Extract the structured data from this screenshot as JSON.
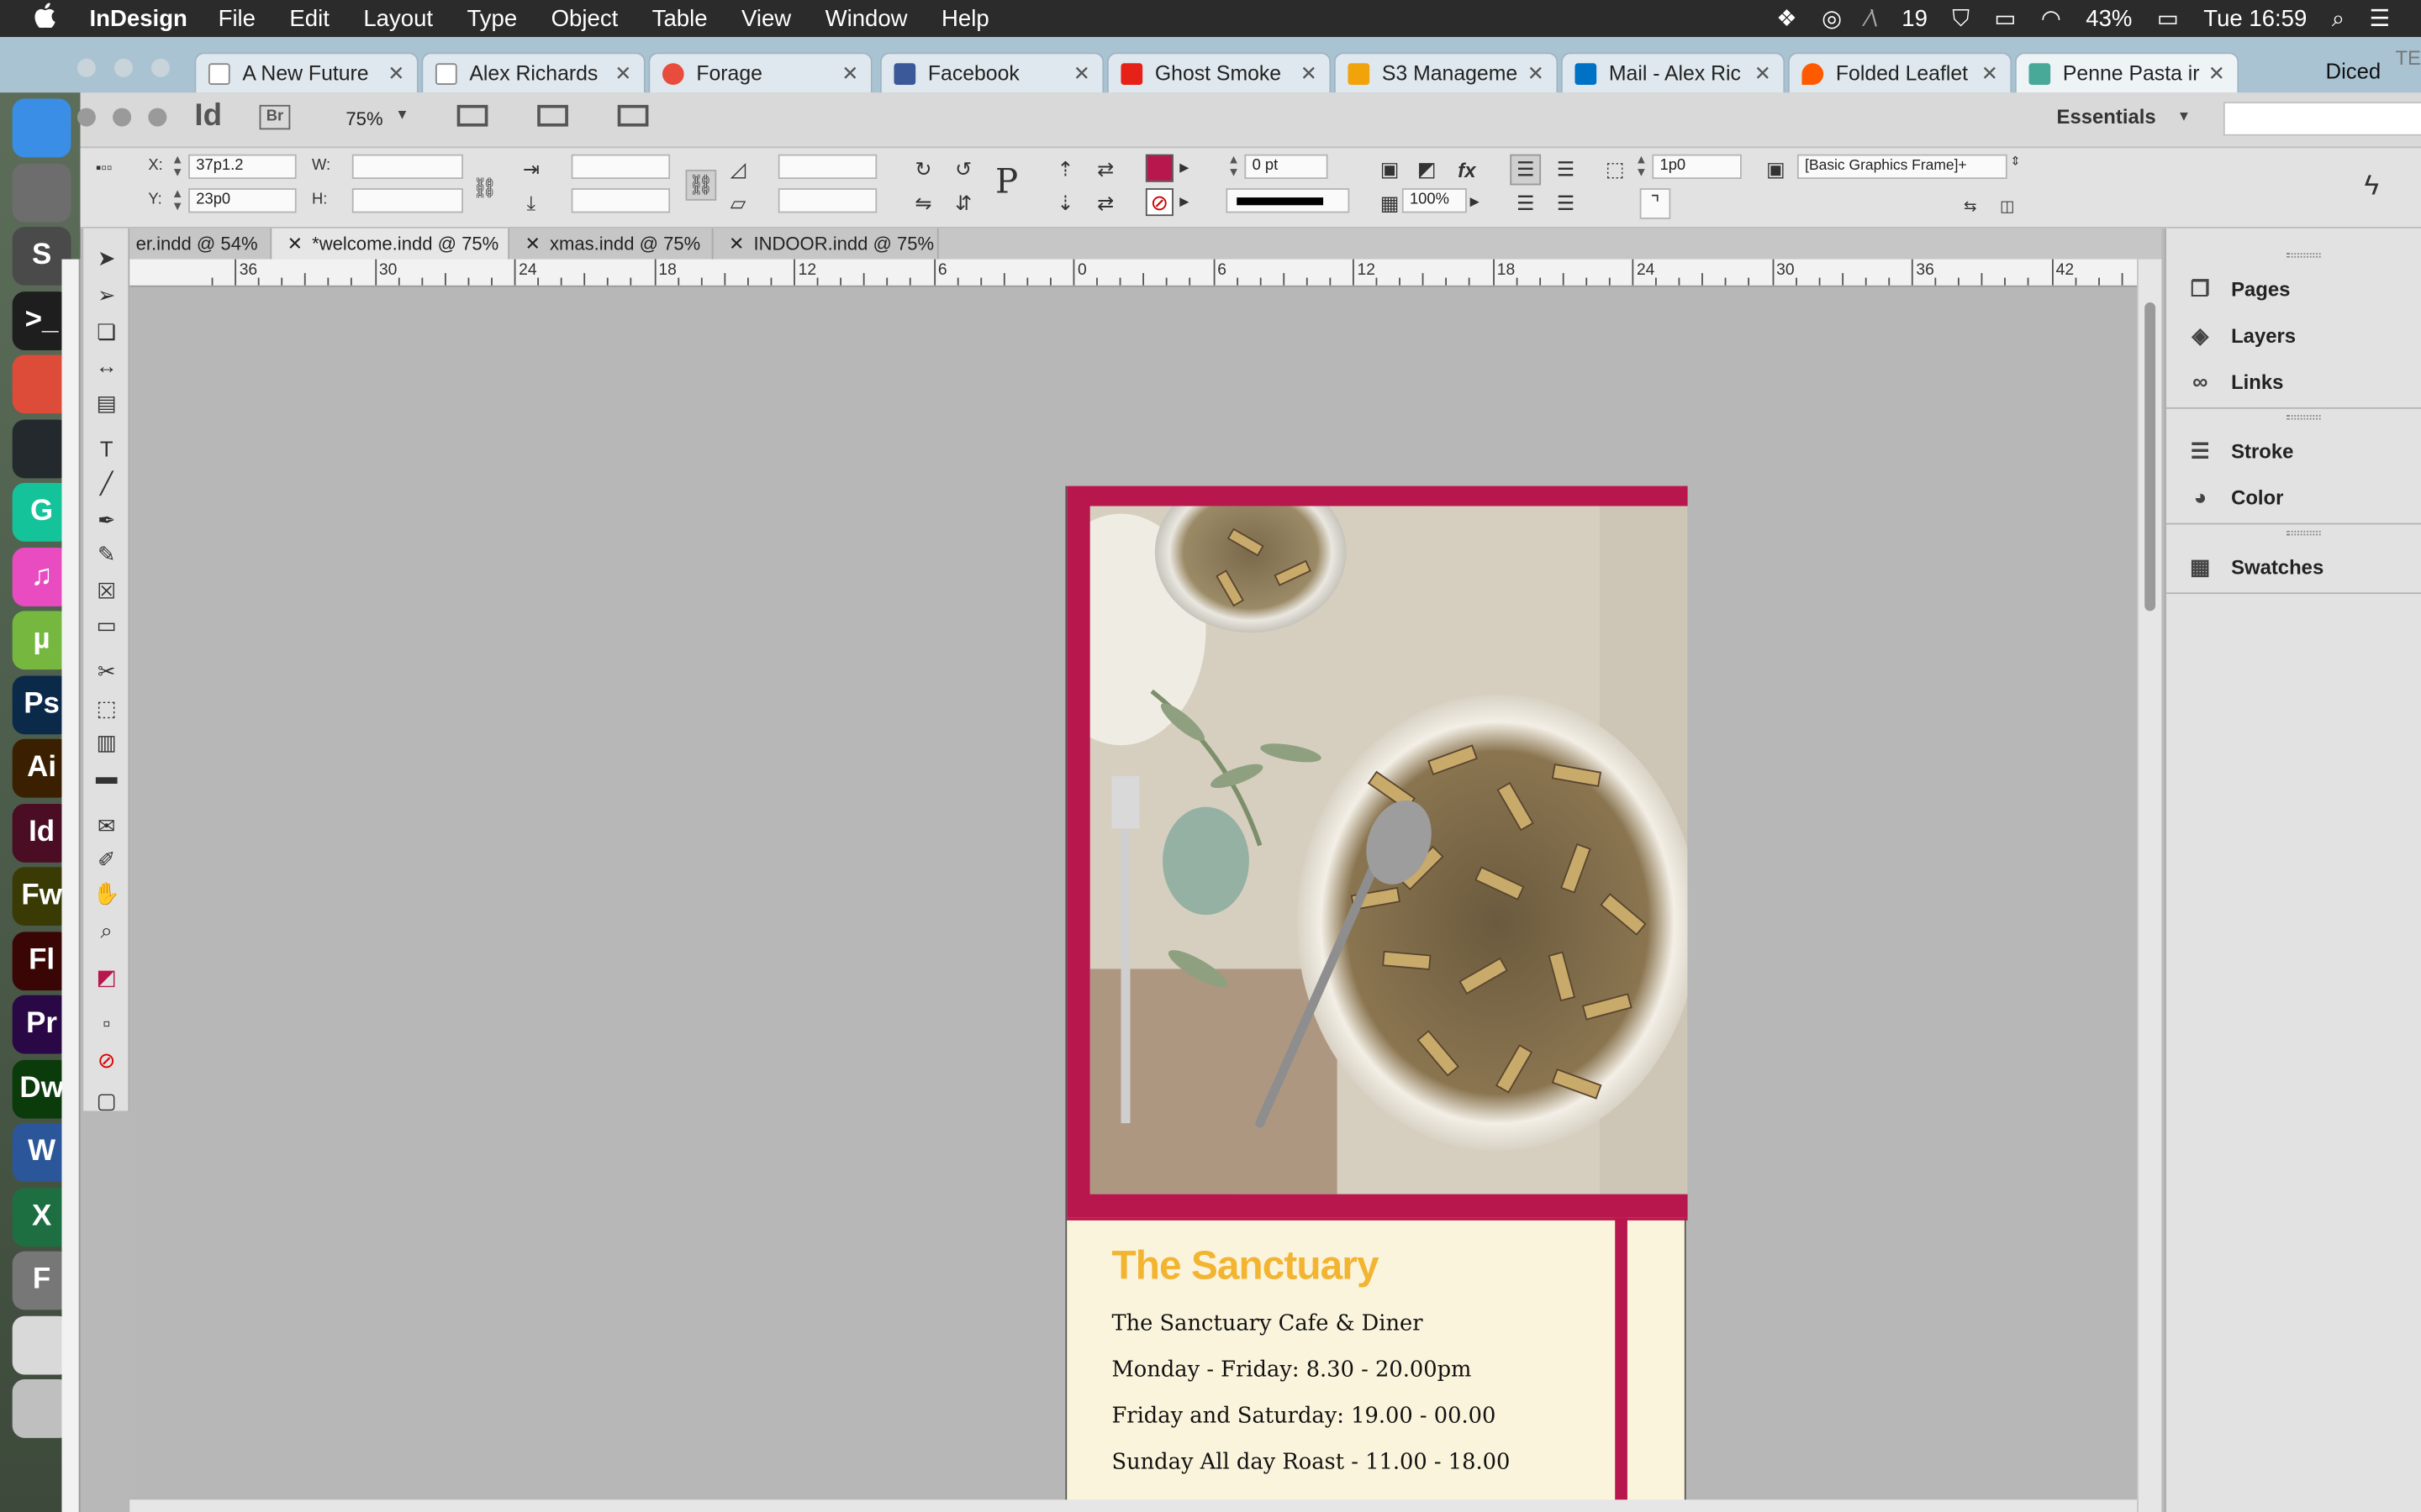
{
  "menubar": {
    "apple": "",
    "app": "InDesign",
    "menus": [
      "File",
      "Edit",
      "Layout",
      "Type",
      "Object",
      "Table",
      "View",
      "Window",
      "Help"
    ],
    "status": {
      "badge": "19",
      "battery": "43%",
      "clock": "Tue 16:59"
    }
  },
  "browser": {
    "tabs": [
      {
        "label": "A New Future",
        "icon_color": "#ffffff"
      },
      {
        "label": "Alex Richards",
        "icon_color": "#ffffff"
      },
      {
        "label": "Forage",
        "icon_color": "#e74c3c"
      },
      {
        "label": "Facebook",
        "icon_color": "#3b5998"
      },
      {
        "label": "Ghost Smoke",
        "icon_color": "#e62117"
      },
      {
        "label": "S3 Manageme",
        "icon_color": "#f0a30a"
      },
      {
        "label": "Mail - Alex Ric",
        "icon_color": "#0072c6"
      },
      {
        "label": "Folded Leaflet",
        "icon_color": "#ff5a00"
      },
      {
        "label": "Penne Pasta ir",
        "icon_color": "#48a999"
      }
    ],
    "profile": "Diced",
    "overflow": "TE"
  },
  "app": {
    "logo": "Id",
    "bridge": "Br",
    "zoom": "75%",
    "workspace": "Essentials"
  },
  "control": {
    "x_label": "X:",
    "x_value": "37p1.2",
    "y_label": "Y:",
    "y_value": "23p0",
    "w_label": "W:",
    "h_label": "H:",
    "stroke_weight": "0 pt",
    "opacity": "100%",
    "offset": "1p0",
    "object_style": "[Basic Graphics Frame]+",
    "fill_color": "#b8174e"
  },
  "doc_tabs": [
    {
      "label": "er.indd @ 54%"
    },
    {
      "label": "*welcome.indd @ 75%"
    },
    {
      "label": "xmas.indd @ 75%"
    },
    {
      "label": "INDOOR.indd @ 75%"
    }
  ],
  "ruler": {
    "labels": [
      "36",
      "30",
      "24",
      "18",
      "12",
      "6",
      "0",
      "6",
      "12",
      "18",
      "24",
      "30",
      "36",
      "42"
    ]
  },
  "document": {
    "title": "The Sanctuary",
    "lines": [
      "The Sanctuary Cafe & Diner",
      "Monday - Friday: 8.30 - 20.00pm",
      "Friday and Saturday: 19.00 - 00.00",
      "Sunday All day Roast - 11.00 - 18.00"
    ],
    "accent_color": "#b8174e",
    "title_color": "#f2b431",
    "background_color": "#fbf4dc"
  },
  "panels": {
    "items": [
      {
        "label": "Pages",
        "icon": "pages-icon"
      },
      {
        "label": "Layers",
        "icon": "layers-icon"
      },
      {
        "label": "Links",
        "icon": "links-icon"
      },
      {
        "label": "Stroke",
        "icon": "stroke-icon"
      },
      {
        "label": "Color",
        "icon": "color-icon"
      },
      {
        "label": "Swatches",
        "icon": "swatches-icon"
      }
    ]
  },
  "dock": {
    "apps": [
      {
        "label": "",
        "icon": "finder-icon",
        "color": "#3a8ee6"
      },
      {
        "label": "",
        "icon": "system-preferences-icon",
        "color": "#6d6d6d"
      },
      {
        "label": "S",
        "icon": "sublime-icon",
        "color": "#4a4a4a"
      },
      {
        "label": ">_",
        "icon": "terminal-icon",
        "color": "#1e1e1e"
      },
      {
        "label": "",
        "icon": "chrome-icon",
        "color": "#dd4b39"
      },
      {
        "label": "",
        "icon": "github-icon",
        "color": "#24292e"
      },
      {
        "label": "G",
        "icon": "grammarly-icon",
        "color": "#15c39a"
      },
      {
        "label": "♫",
        "icon": "itunes-icon",
        "color": "#e84cc0"
      },
      {
        "label": "µ",
        "icon": "utorrent-icon",
        "color": "#76b83f"
      },
      {
        "label": "Ps",
        "icon": "photoshop-icon",
        "color": "#0b2a4a"
      },
      {
        "label": "Ai",
        "icon": "illustrator-icon",
        "color": "#3a1f00"
      },
      {
        "label": "Id",
        "icon": "indesign-icon",
        "color": "#4a0d24"
      },
      {
        "label": "Fw",
        "icon": "fireworks-icon",
        "color": "#3a3a05"
      },
      {
        "label": "Fl",
        "icon": "flash-icon",
        "color": "#3a0505"
      },
      {
        "label": "Pr",
        "icon": "premiere-icon",
        "color": "#2a0845"
      },
      {
        "label": "Dw",
        "icon": "dreamweaver-icon",
        "color": "#0b3a0b"
      },
      {
        "label": "W",
        "icon": "word-icon",
        "color": "#2b579a"
      },
      {
        "label": "X",
        "icon": "excel-icon",
        "color": "#1d6f42"
      },
      {
        "label": "F",
        "icon": "font-book-icon",
        "color": "#777777"
      },
      {
        "label": "",
        "icon": "preview-icon",
        "color": "#d9d9d9"
      },
      {
        "label": "",
        "icon": "trash-icon",
        "color": "#bfbfbf"
      }
    ]
  }
}
